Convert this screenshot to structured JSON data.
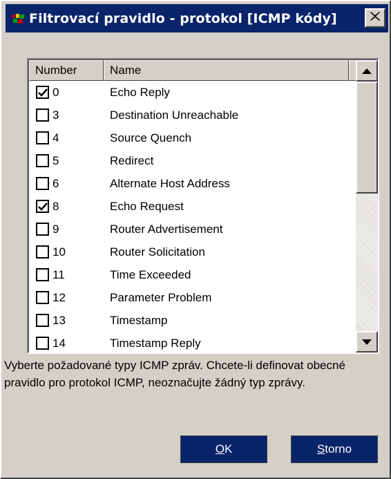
{
  "window": {
    "title": "Filtrovací pravidlo - protokol [ICMP kódy]"
  },
  "list": {
    "columns": {
      "number": "Number",
      "name": "Name"
    },
    "rows": [
      {
        "number": "0",
        "name": "Echo Reply",
        "checked": true
      },
      {
        "number": "3",
        "name": "Destination Unreachable",
        "checked": false
      },
      {
        "number": "4",
        "name": "Source Quench",
        "checked": false
      },
      {
        "number": "5",
        "name": "Redirect",
        "checked": false
      },
      {
        "number": "6",
        "name": "Alternate Host Address",
        "checked": false
      },
      {
        "number": "8",
        "name": "Echo Request",
        "checked": true
      },
      {
        "number": "9",
        "name": "Router Advertisement",
        "checked": false
      },
      {
        "number": "10",
        "name": "Router Solicitation",
        "checked": false
      },
      {
        "number": "11",
        "name": "Time Exceeded",
        "checked": false
      },
      {
        "number": "12",
        "name": "Parameter Problem",
        "checked": false
      },
      {
        "number": "13",
        "name": "Timestamp",
        "checked": false
      },
      {
        "number": "14",
        "name": "Timestamp Reply",
        "checked": false
      }
    ]
  },
  "info_text": "Vyberte požadované typy ICMP zpráv. Chcete-li definovat obecné pravidlo pro protokol ICMP, neoznačujte žádný typ zprávy.",
  "buttons": {
    "ok": {
      "accel": "O",
      "rest": "K"
    },
    "cancel": {
      "accel": "S",
      "rest": "torno"
    }
  },
  "icons": {
    "app": "app-icon",
    "close": "close-icon",
    "scroll_up": "arrow-up-icon",
    "scroll_down": "arrow-down-icon",
    "check": "checkmark-icon"
  },
  "colors": {
    "titlebar": "#0a246a",
    "window": "#d4d0c8",
    "button": "#0a246a"
  }
}
